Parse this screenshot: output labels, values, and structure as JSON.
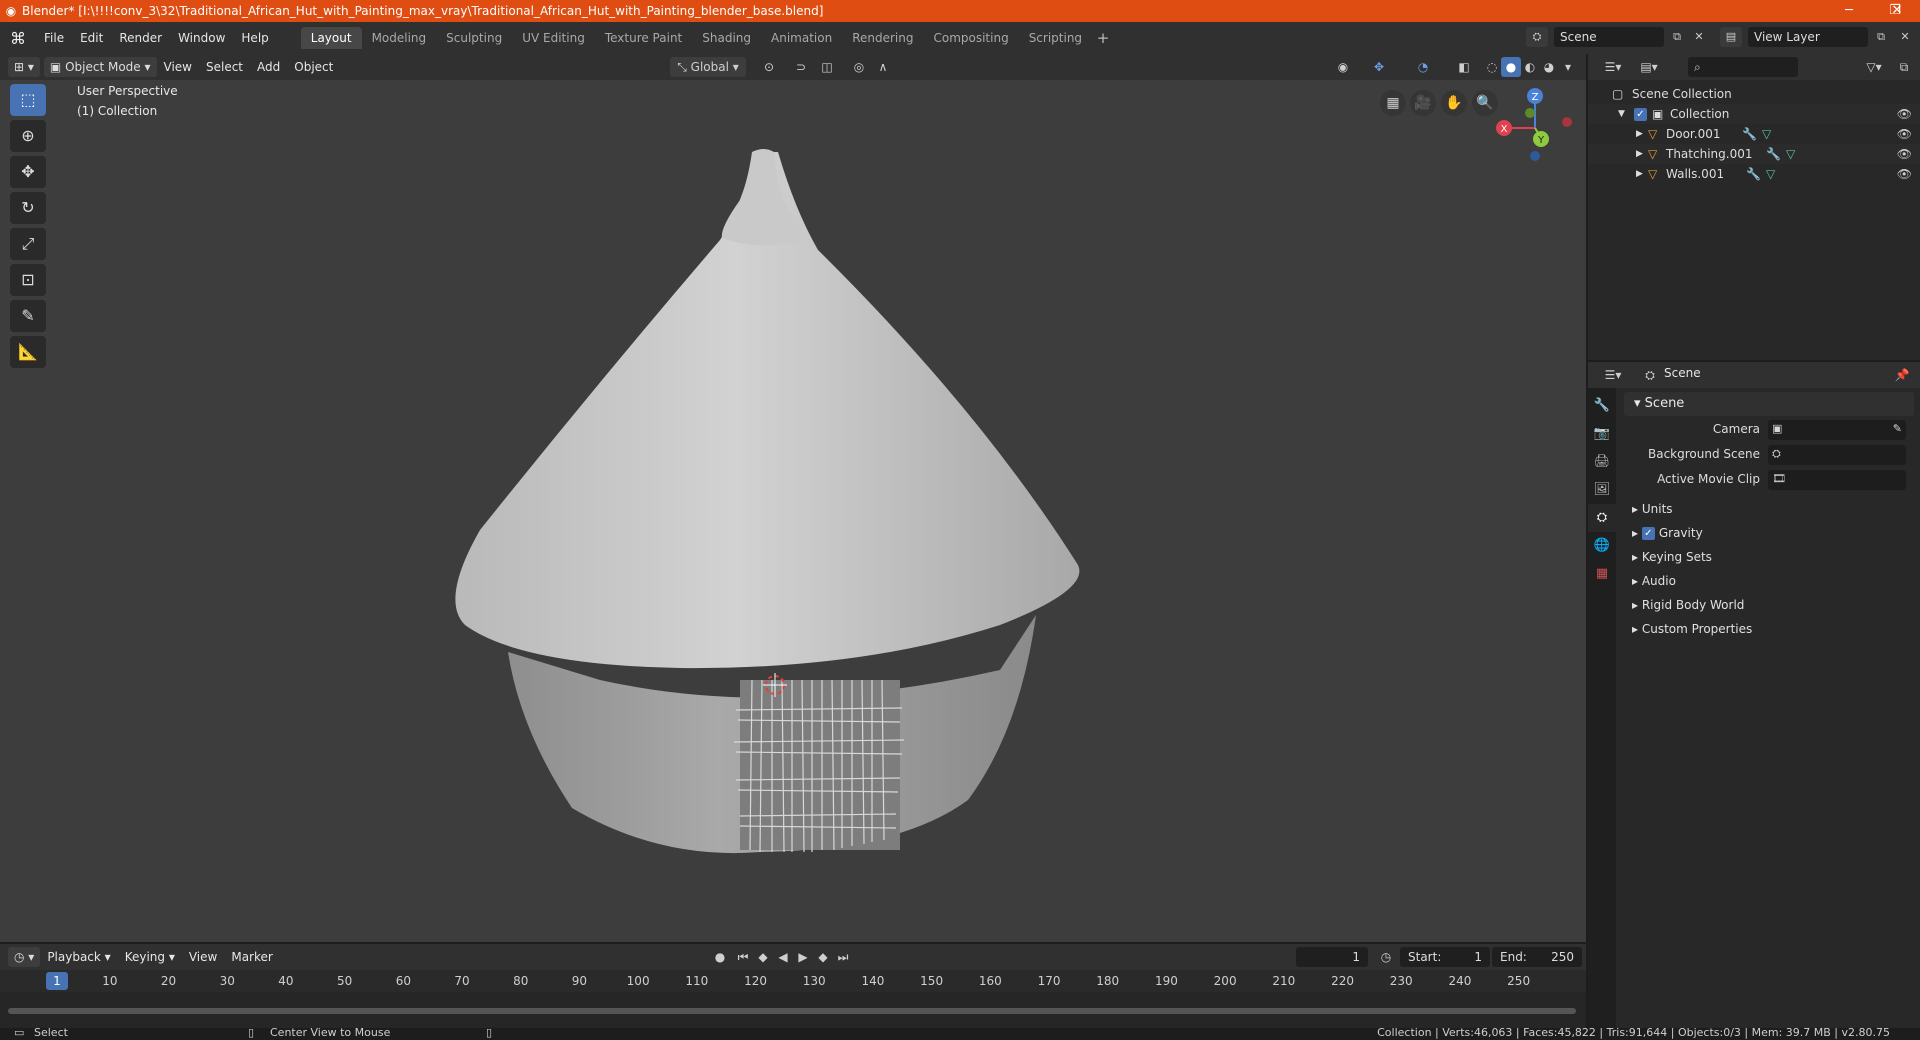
{
  "window": {
    "title": "Blender* [I:\\!!!!conv_3\\32\\Traditional_African_Hut_with_Painting_max_vray\\Traditional_African_Hut_with_Painting_blender_base.blend]",
    "minimize": "─",
    "maximize": "❐",
    "close": "✕"
  },
  "menu": [
    "File",
    "Edit",
    "Render",
    "Window",
    "Help"
  ],
  "workspaces": [
    "Layout",
    "Modeling",
    "Sculpting",
    "UV Editing",
    "Texture Paint",
    "Shading",
    "Animation",
    "Rendering",
    "Compositing",
    "Scripting"
  ],
  "active_workspace": "Layout",
  "scene_selector": "Scene",
  "view_layer": "View Layer",
  "viewport": {
    "mode": "Object Mode",
    "menus": [
      "View",
      "Select",
      "Add",
      "Object"
    ],
    "orientation": "Global",
    "info_line1": "User Perspective",
    "info_line2": "(1) Collection",
    "gizmo_labels": {
      "x": "X",
      "y": "Y",
      "z": "Z"
    }
  },
  "outliner": {
    "root": "Scene Collection",
    "collection": "Collection",
    "objects": [
      "Door.001",
      "Thatching.001",
      "Walls.001"
    ]
  },
  "properties": {
    "header": "Scene",
    "panel_title": "Scene",
    "fields": {
      "camera": "Camera",
      "background_scene": "Background Scene",
      "active_movie_clip": "Active Movie Clip"
    },
    "subpanels": [
      "Units",
      "Gravity",
      "Keying Sets",
      "Audio",
      "Rigid Body World",
      "Custom Properties"
    ],
    "gravity_checked": true
  },
  "timeline": {
    "menus": [
      "Playback",
      "Keying",
      "View",
      "Marker"
    ],
    "current_frame": "1",
    "start_label": "Start:",
    "start": "1",
    "end_label": "End:",
    "end": "250",
    "ticks": [
      "10",
      "20",
      "30",
      "40",
      "50",
      "60",
      "70",
      "80",
      "90",
      "100",
      "110",
      "120",
      "130",
      "140",
      "150",
      "160",
      "170",
      "180",
      "190",
      "200",
      "210",
      "220",
      "230",
      "240",
      "250"
    ]
  },
  "status": {
    "left_action": "Select",
    "middle_action": "Center View to Mouse",
    "stats": "Collection | Verts:46,063 | Faces:45,822 | Tris:91,644 | Objects:0/3 | Mem: 39.7 MB | v2.80.75"
  },
  "colors": {
    "title_bar": "#e04d12",
    "accent": "#4772b3",
    "viewport_bg": "#3d3d3d",
    "object_orange": "#e39a3c",
    "modifier_blue": "#6fa0e6",
    "mesh_green": "#57c296"
  }
}
